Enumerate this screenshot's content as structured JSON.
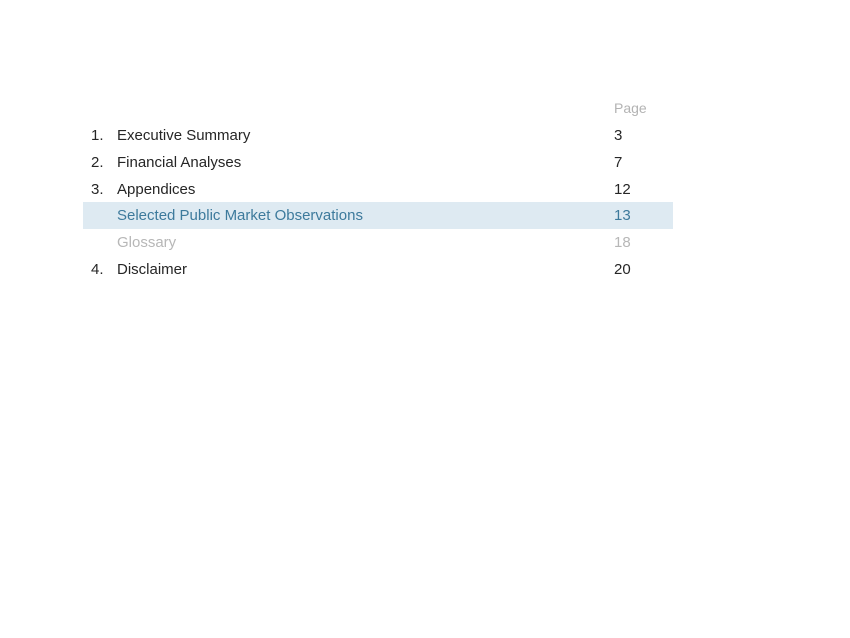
{
  "toc": {
    "page_column_header": "Page",
    "entries": [
      {
        "number": "1.",
        "title": "Executive Summary",
        "page": "3",
        "state": "normal"
      },
      {
        "number": "2.",
        "title": "Financial Analyses",
        "page": "7",
        "state": "normal"
      },
      {
        "number": "3.",
        "title": "Appendices",
        "page": "12",
        "state": "normal"
      },
      {
        "number": "",
        "title": "Selected Public Market Observations",
        "page": "13",
        "state": "active"
      },
      {
        "number": "",
        "title": "Glossary",
        "page": "18",
        "state": "muted"
      },
      {
        "number": "4.",
        "title": "Disclaimer",
        "page": "20",
        "state": "normal"
      }
    ]
  },
  "colors": {
    "active_text": "#3d7a9c",
    "active_background": "#deeaf2",
    "muted_text": "#b7b7b7",
    "normal_text": "#262626"
  }
}
